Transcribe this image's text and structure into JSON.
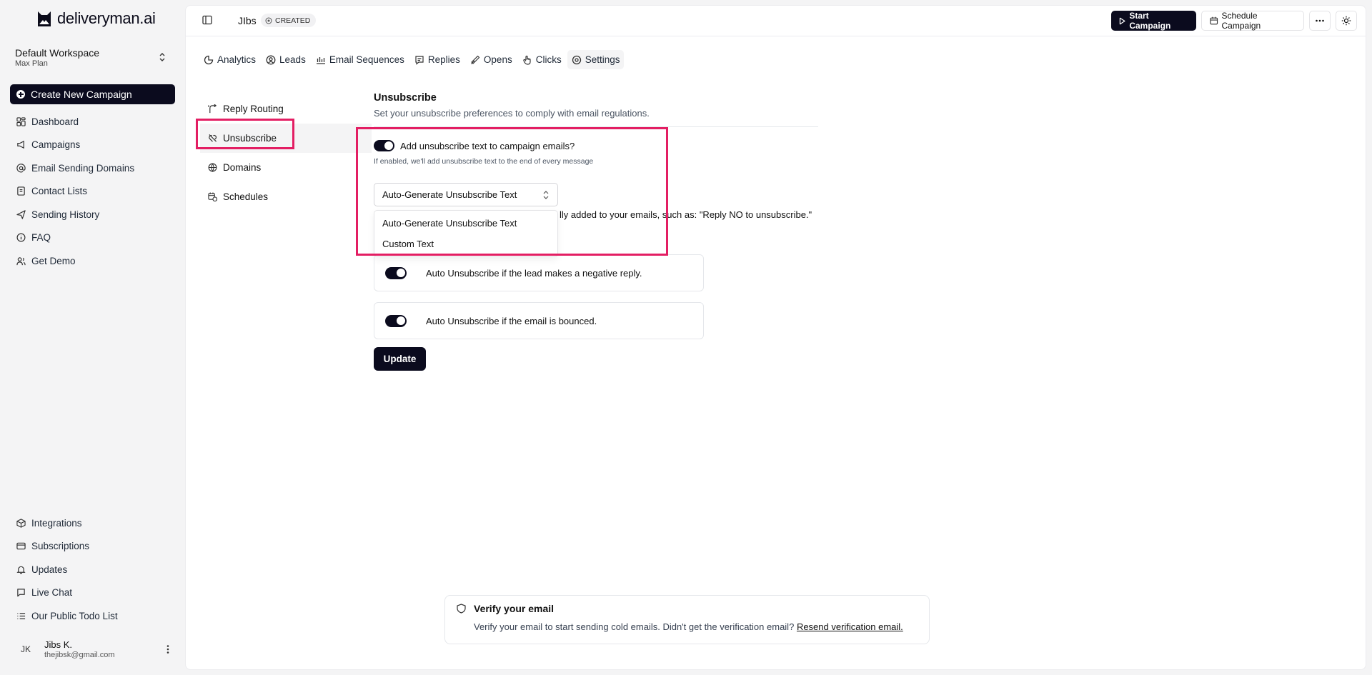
{
  "brand": {
    "name": "deliveryman.ai"
  },
  "workspace": {
    "name": "Default Workspace",
    "plan": "Max Plan"
  },
  "sidebar": {
    "create_label": "Create New Campaign",
    "items": [
      {
        "label": "Dashboard",
        "icon": "dashboard-icon"
      },
      {
        "label": "Campaigns",
        "icon": "megaphone-icon"
      },
      {
        "label": "Email Sending Domains",
        "icon": "at-sign-icon"
      },
      {
        "label": "Contact Lists",
        "icon": "contact-list-icon"
      },
      {
        "label": "Sending History",
        "icon": "send-icon"
      },
      {
        "label": "FAQ",
        "icon": "info-icon"
      },
      {
        "label": "Get Demo",
        "icon": "users-icon"
      }
    ],
    "bottom_items": [
      {
        "label": "Integrations",
        "icon": "box-icon"
      },
      {
        "label": "Subscriptions",
        "icon": "card-icon"
      },
      {
        "label": "Updates",
        "icon": "bell-icon"
      },
      {
        "label": "Live Chat",
        "icon": "chat-icon"
      },
      {
        "label": "Our Public Todo List",
        "icon": "list-icon"
      }
    ]
  },
  "user": {
    "initials": "JK",
    "name": "Jibs K.",
    "email": "thejibsk@gmail.com"
  },
  "header": {
    "campaign_name": "JIbs",
    "status": "CREATED",
    "start_label": "Start Campaign",
    "schedule_label": "Schedule Campaign"
  },
  "tabs": [
    {
      "label": "Analytics",
      "icon": "pie-chart-icon"
    },
    {
      "label": "Leads",
      "icon": "user-circle-icon"
    },
    {
      "label": "Email Sequences",
      "icon": "sequence-icon"
    },
    {
      "label": "Replies",
      "icon": "reply-icon"
    },
    {
      "label": "Opens",
      "icon": "open-icon"
    },
    {
      "label": "Clicks",
      "icon": "pointer-icon"
    },
    {
      "label": "Settings",
      "icon": "settings-icon",
      "active": true
    }
  ],
  "settings_nav": [
    {
      "label": "Reply Routing",
      "icon": "routing-icon"
    },
    {
      "label": "Unsubscribe",
      "icon": "unsubscribe-icon",
      "active": true
    },
    {
      "label": "Domains",
      "icon": "globe-icon"
    },
    {
      "label": "Schedules",
      "icon": "calendar-icon"
    }
  ],
  "unsubscribe": {
    "title": "Unsubscribe",
    "subtitle": "Set your unsubscribe preferences to comply with email regulations.",
    "toggle_label": "Add unsubscribe text to campaign emails?",
    "toggle_enabled": true,
    "toggle_hint": "If enabled, we'll add unsubscribe text to the end of every message",
    "selected_option": "Auto-Generate Unsubscribe Text",
    "options": [
      "Auto-Generate Unsubscribe Text",
      "Custom Text"
    ],
    "obscured_hint": "lly added to your emails, such as: \"Reply NO to unsubscribe.\"",
    "auto_negative_label": "Auto Unsubscribe if the lead makes a negative reply.",
    "auto_negative_enabled": true,
    "auto_bounce_label": "Auto Unsubscribe if the email is bounced.",
    "auto_bounce_enabled": true,
    "update_label": "Update"
  },
  "verify": {
    "title": "Verify your email",
    "text": "Verify your email to start sending cold emails. Didn't get the verification email?",
    "link": "Resend verification email."
  },
  "colors": {
    "primary": "#0b0b1e",
    "highlight": "#e31e63",
    "background": "#f4f4f5"
  }
}
